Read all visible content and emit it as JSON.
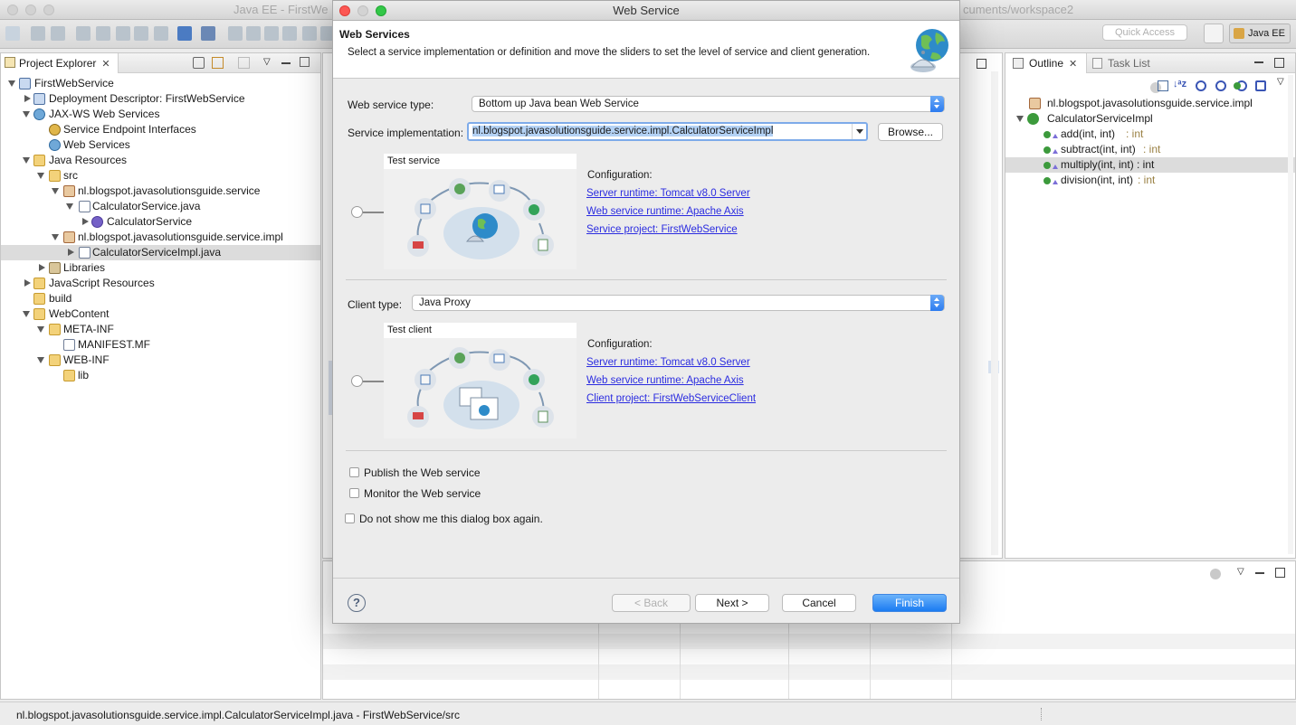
{
  "window": {
    "title_left": "Java EE - FirstWe",
    "title_right": "cuments/workspace2"
  },
  "toolbar": {
    "quick_access_placeholder": "Quick Access",
    "perspective_label": "Java EE"
  },
  "project_explorer": {
    "tab_label": "Project Explorer",
    "tree": [
      {
        "label": "FirstWebService",
        "icon": "project-icon"
      },
      {
        "label": "Deployment Descriptor: FirstWebService",
        "icon": "deployment-descriptor-icon"
      },
      {
        "label": "JAX-WS Web Services",
        "icon": "jaxws-icon"
      },
      {
        "label": "Service Endpoint Interfaces",
        "icon": "endpoint-interface-icon"
      },
      {
        "label": "Web Services",
        "icon": "web-services-icon"
      },
      {
        "label": "Java Resources",
        "icon": "java-resources-icon"
      },
      {
        "label": "src",
        "icon": "source-folder-icon"
      },
      {
        "label": "nl.blogspot.javasolutionsguide.service",
        "icon": "package-icon"
      },
      {
        "label": "CalculatorService.java",
        "icon": "java-file-icon"
      },
      {
        "label": "CalculatorService",
        "icon": "interface-icon"
      },
      {
        "label": "nl.blogspot.javasolutionsguide.service.impl",
        "icon": "package-icon"
      },
      {
        "label": "CalculatorServiceImpl.java",
        "icon": "java-file-icon"
      },
      {
        "label": "Libraries",
        "icon": "libraries-icon"
      },
      {
        "label": "JavaScript Resources",
        "icon": "javascript-resources-icon"
      },
      {
        "label": "build",
        "icon": "folder-icon"
      },
      {
        "label": "WebContent",
        "icon": "folder-icon"
      },
      {
        "label": "META-INF",
        "icon": "folder-icon"
      },
      {
        "label": "MANIFEST.MF",
        "icon": "file-icon"
      },
      {
        "label": "WEB-INF",
        "icon": "folder-icon"
      },
      {
        "label": "lib",
        "icon": "folder-icon"
      }
    ]
  },
  "outline": {
    "tab_label": "Outline",
    "task_list_label": "Task List",
    "package": "nl.blogspot.javasolutionsguide.service.impl",
    "class_name": "CalculatorServiceImpl",
    "methods": [
      {
        "sig": "add(int, int)",
        "ret": " : int"
      },
      {
        "sig": "subtract(int, int)",
        "ret": " : int"
      },
      {
        "sig": "multiply(int, int) : int",
        "ret": ""
      },
      {
        "sig": "division(int, int)",
        "ret": " : int"
      }
    ]
  },
  "status_bar": {
    "text": "nl.blogspot.javasolutionsguide.service.impl.CalculatorServiceImpl.java - FirstWebService/src"
  },
  "dialog": {
    "title": "Web Service",
    "heading": "Web Services",
    "description": "Select a service implementation or definition and move the sliders to set the level of service and client generation.",
    "service_type_label": "Web service type:",
    "service_type_value": "Bottom up Java bean Web Service",
    "impl_label": "Service implementation:",
    "impl_value": "nl.blogspot.javasolutionsguide.service.impl.CalculatorServiceImpl",
    "browse_label": "Browse...",
    "service_panel": {
      "caption": "Test service",
      "config_label": "Configuration:",
      "links": [
        "Server runtime: Tomcat v8.0 Server",
        "Web service runtime: Apache Axis",
        "Service project: FirstWebService"
      ]
    },
    "client_type_label": "Client type:",
    "client_type_value": "Java Proxy",
    "client_panel": {
      "caption": "Test client",
      "config_label": "Configuration:",
      "links": [
        "Server runtime: Tomcat v8.0 Server",
        "Web service runtime: Apache Axis",
        "Client project: FirstWebServiceClient"
      ]
    },
    "publish_label": "Publish the Web service",
    "monitor_label": "Monitor the Web service",
    "dont_show_label": "Do not show me this dialog box again.",
    "help_glyph": "?",
    "buttons": {
      "back": "< Back",
      "next": "Next >",
      "cancel": "Cancel",
      "finish": "Finish"
    }
  },
  "colors": {
    "accent": "#1a7bf2",
    "link": "#2b2ce0",
    "selection": "#b4d2f5"
  }
}
